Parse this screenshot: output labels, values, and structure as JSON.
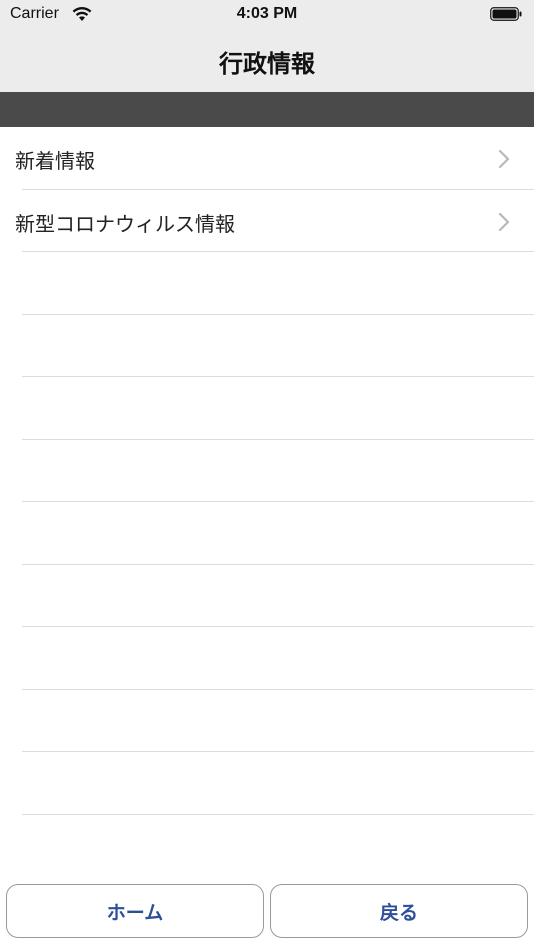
{
  "status_bar": {
    "carrier": "Carrier",
    "time": "4:03 PM",
    "wifi_icon": "wifi-icon",
    "battery_icon": "battery-icon"
  },
  "nav": {
    "title": "行政情報"
  },
  "list": {
    "items": [
      {
        "label": "新着情報",
        "icon": "chevron-right-icon"
      },
      {
        "label": "新型コロナウィルス情報",
        "icon": "chevron-right-icon"
      }
    ],
    "empty_rows": 10
  },
  "bottom": {
    "home_label": "ホーム",
    "back_label": "戻る"
  },
  "colors": {
    "nav_background": "#ececec",
    "band": "#4a4a4a",
    "button_text": "#2d4f9b",
    "separator": "#dcdcdc"
  }
}
